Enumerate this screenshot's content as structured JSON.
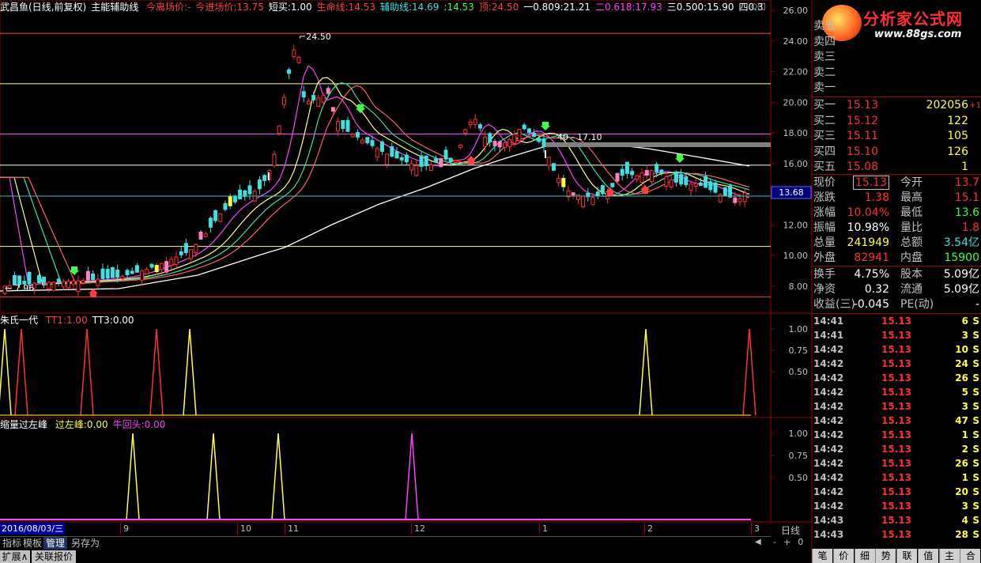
{
  "header": {
    "stock_title": "武昌鱼(日线,前复权)",
    "indicator_name": "主能辅助线",
    "items": [
      {
        "label": "今离场价:",
        "value": "-",
        "color": "#ff4040"
      },
      {
        "label": "今进场价:",
        "value": "13.75",
        "color": "#ff4040"
      },
      {
        "label": "短买:",
        "value": "1.00",
        "color": "#ffffff"
      },
      {
        "label": "生命线:",
        "value": "14.53",
        "color": "#ff4040"
      },
      {
        "label": "辅助线:",
        "value": "14.69",
        "color": "#40e0e0"
      },
      {
        "label": ":",
        "value": "14.53",
        "color": "#40ff40"
      },
      {
        "label": "顶:",
        "value": "24.50",
        "color": "#ff4040"
      },
      {
        "label": "一0.809:",
        "value": "21.21",
        "color": "#ffffff"
      },
      {
        "label": "二0.618:",
        "value": "17.93",
        "color": "#ff40ff"
      },
      {
        "label": "三0.500:",
        "value": "15.90",
        "color": "#ffffff"
      },
      {
        "label": "四0.3",
        "value": "",
        "color": "#ffffff"
      }
    ]
  },
  "main_chart": {
    "price_labels": [
      "26.00",
      "24.00",
      "22.00",
      "20.00",
      "18.00",
      "16.00",
      "13.68",
      "12.00",
      "10.00",
      "8.00"
    ],
    "high_annotation": "24.50",
    "low_annotation": "7.96",
    "mid_annotation": "40 - 17.10",
    "current_price_tag": "13.68"
  },
  "sub1": {
    "title": "朱氏一代",
    "items": [
      {
        "label": "TT1:",
        "value": "1.00",
        "color": "#ff4040"
      },
      {
        "label": "TT3:",
        "value": "0.00",
        "color": "#ffffff"
      }
    ],
    "scale_labels": [
      "1.00",
      "0.75",
      "0.50"
    ]
  },
  "sub2": {
    "title": "缩量过左峰",
    "items": [
      {
        "label": "过左峰:",
        "value": "0.00",
        "color": "#ffff40"
      },
      {
        "label": "牛回头:",
        "value": "0.00",
        "color": "#ff40ff"
      }
    ],
    "scale_labels": [
      "1.00",
      "0.75",
      "0.50"
    ]
  },
  "time_axis": {
    "current_date": "2016/08/03/三",
    "ticks": [
      "9",
      "10",
      "11",
      "12",
      "1",
      "2",
      "3"
    ],
    "period": "日线"
  },
  "bottom_tabs": [
    "指标",
    "模板",
    "管理",
    "另存为"
  ],
  "bottom_links": [
    "扩展∧",
    "关联报价"
  ],
  "watermark": {
    "site": "分析家公式网",
    "url": "www.88gs.com"
  },
  "order_book": {
    "asks": [
      {
        "label": "卖五",
        "price": "",
        "vol": ""
      },
      {
        "label": "卖四",
        "price": "",
        "vol": ""
      },
      {
        "label": "卖三",
        "price": "",
        "vol": ""
      },
      {
        "label": "卖二",
        "price": "",
        "vol": ""
      },
      {
        "label": "卖一",
        "price": "",
        "vol": ""
      }
    ],
    "bids": [
      {
        "label": "买一",
        "price": "15.13",
        "vol": "202056",
        "chg": "+1"
      },
      {
        "label": "买二",
        "price": "15.12",
        "vol": "122",
        "chg": ""
      },
      {
        "label": "买三",
        "price": "15.11",
        "vol": "105",
        "chg": ""
      },
      {
        "label": "买四",
        "price": "15.10",
        "vol": "126",
        "chg": ""
      },
      {
        "label": "买五",
        "price": "15.08",
        "vol": "1",
        "chg": ""
      }
    ]
  },
  "quote": [
    {
      "l1": "现价",
      "v1": "15.13",
      "c1": "#ff3030",
      "l2": "今开",
      "v2": "13.7",
      "c2": "#ff3030"
    },
    {
      "l1": "涨跌",
      "v1": "1.38",
      "c1": "#ff3030",
      "l2": "最高",
      "v2": "15.1",
      "c2": "#ff3030"
    },
    {
      "l1": "涨幅",
      "v1": "10.04%",
      "c1": "#ff3030",
      "l2": "最低",
      "v2": "13.6",
      "c2": "#40ff40"
    },
    {
      "l1": "振幅",
      "v1": "10.98%",
      "c1": "#ffffff",
      "l2": "量比",
      "v2": "1.8",
      "c2": "#ff3030"
    },
    {
      "l1": "总量",
      "v1": "241949",
      "c1": "#ffff40",
      "l2": "总额",
      "v2": "3.54亿",
      "c2": "#40e0e0"
    },
    {
      "l1": "外盘",
      "v1": "82941",
      "c1": "#ff3030",
      "l2": "内盘",
      "v2": "15900",
      "c2": "#40ff40"
    },
    {
      "l1": "换手",
      "v1": "4.75%",
      "c1": "#ffffff",
      "l2": "股本",
      "v2": "5.09亿",
      "c2": "#ffffff"
    },
    {
      "l1": "净资",
      "v1": "0.32",
      "c1": "#ffffff",
      "l2": "流通",
      "v2": "5.09亿",
      "c2": "#ffffff"
    },
    {
      "l1": "收益(三)",
      "v1": "-0.045",
      "c1": "#ffffff",
      "l2": "PE(动)",
      "v2": "-",
      "c2": "#ffffff"
    }
  ],
  "ticks": [
    {
      "t": "14:41",
      "p": "15.13",
      "v": "6",
      "d": "S"
    },
    {
      "t": "14:41",
      "p": "15.13",
      "v": "3",
      "d": "S"
    },
    {
      "t": "14:42",
      "p": "15.13",
      "v": "10",
      "d": "S"
    },
    {
      "t": "14:42",
      "p": "15.13",
      "v": "24",
      "d": "S"
    },
    {
      "t": "14:42",
      "p": "15.13",
      "v": "26",
      "d": "S"
    },
    {
      "t": "14:42",
      "p": "15.13",
      "v": "5",
      "d": "S"
    },
    {
      "t": "14:42",
      "p": "15.13",
      "v": "3",
      "d": "S"
    },
    {
      "t": "14:42",
      "p": "15.13",
      "v": "47",
      "d": "S"
    },
    {
      "t": "14:42",
      "p": "15.13",
      "v": "1",
      "d": "S"
    },
    {
      "t": "14:42",
      "p": "15.13",
      "v": "2",
      "d": "S"
    },
    {
      "t": "14:42",
      "p": "15.13",
      "v": "26",
      "d": "S"
    },
    {
      "t": "14:42",
      "p": "15.13",
      "v": "1",
      "d": "S"
    },
    {
      "t": "14:42",
      "p": "15.13",
      "v": "20",
      "d": "S"
    },
    {
      "t": "14:42",
      "p": "15.13",
      "v": "3",
      "d": "S"
    },
    {
      "t": "14:43",
      "p": "15.13",
      "v": "4",
      "d": "S"
    },
    {
      "t": "14:43",
      "p": "15.13",
      "v": "28",
      "d": "S"
    }
  ],
  "right_bottom_buttons": [
    "笔",
    "价",
    "细",
    "势",
    "联",
    "值",
    "主",
    "合"
  ]
}
